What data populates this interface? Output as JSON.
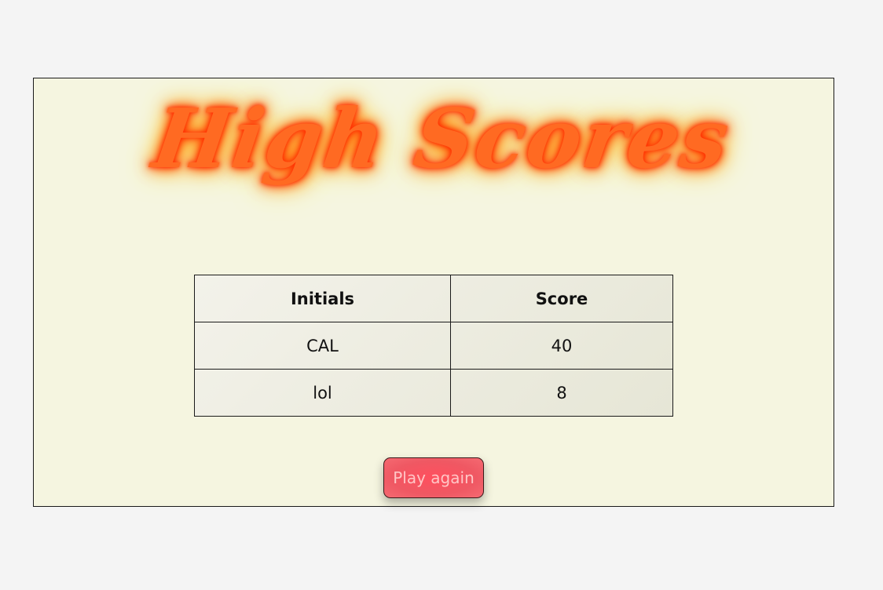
{
  "page": {
    "title": "High Scores"
  },
  "scores_table": {
    "headers": {
      "initials": "Initials",
      "score": "Score"
    },
    "rows": [
      {
        "initials": "CAL",
        "score": "40"
      },
      {
        "initials": "lol",
        "score": "8"
      }
    ]
  },
  "actions": {
    "play_again_label": "Play again"
  },
  "colors": {
    "background": "#f4f4f4",
    "panel": "#f5f5e0",
    "title_fill": "#ff6a22",
    "title_glow": "#ff3300",
    "button": "#ef5863",
    "button_text": "#ffc6c6"
  }
}
